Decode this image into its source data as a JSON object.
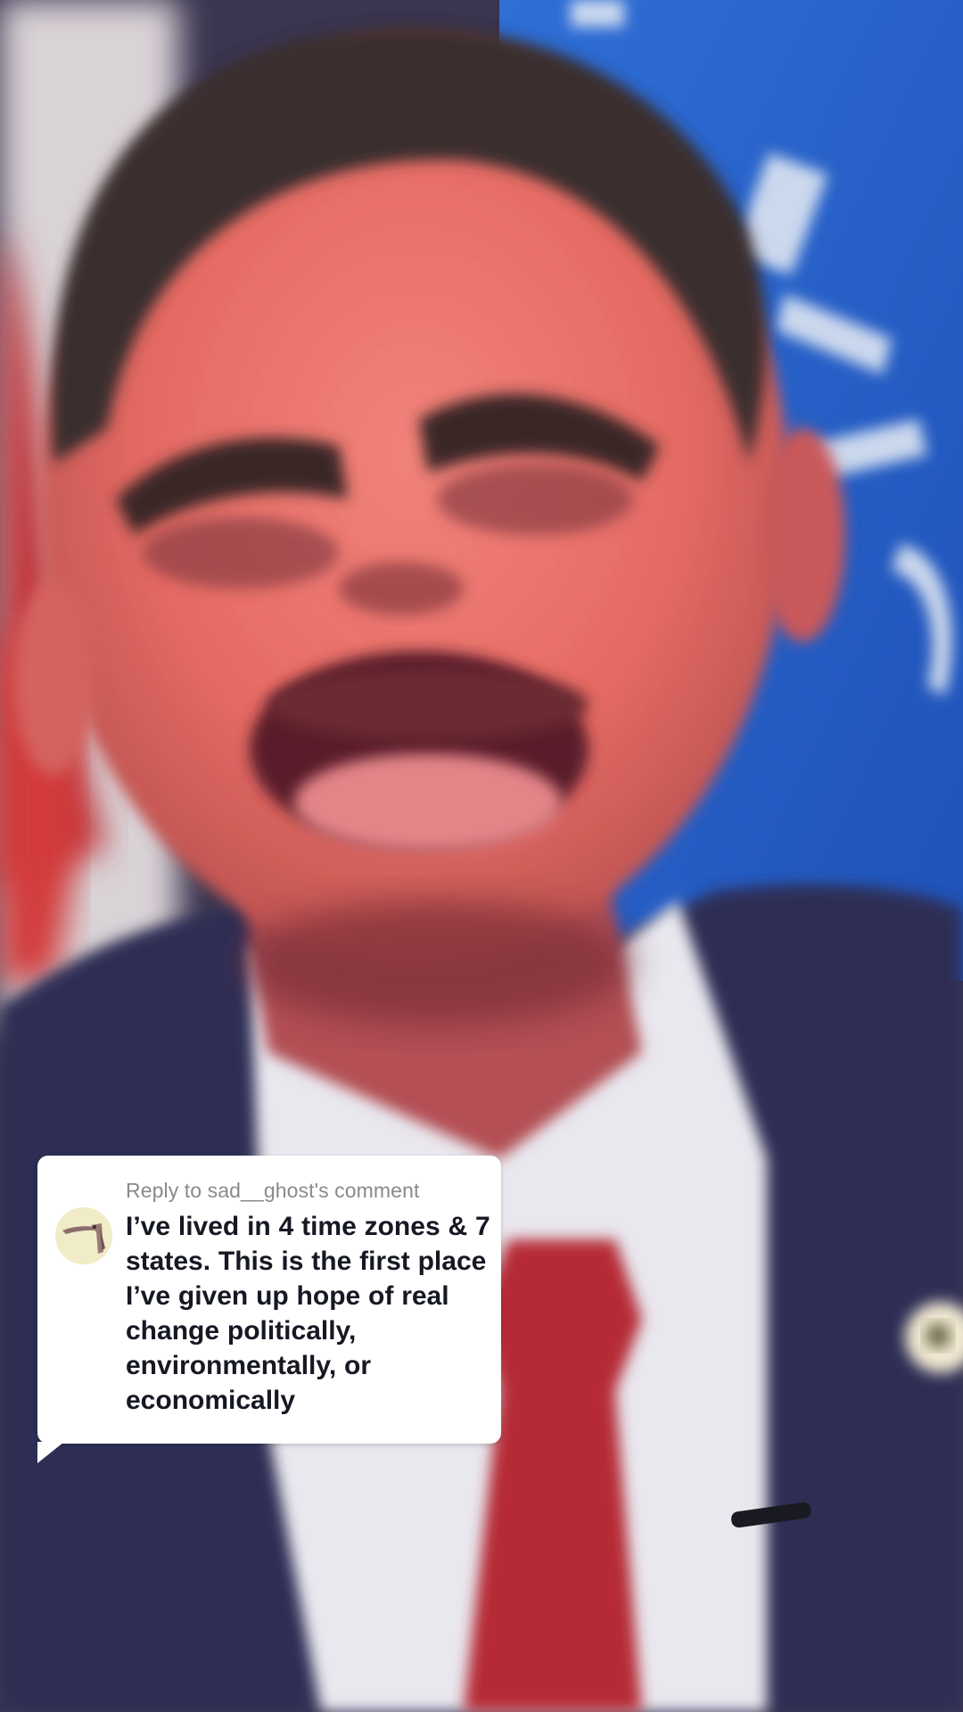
{
  "reply": {
    "header": "Reply to sad__ghost's comment",
    "text": "I’ve lived in 4 time zones & 7 states. This is the first place I’ve given up hope of real change politically, environmentally, or economically"
  },
  "icons": {
    "avatar": "user-avatar-bird",
    "tail": "speech-bubble-tail"
  },
  "colors": {
    "card_background": "#ffffff",
    "header_text": "#8a8a8a",
    "body_text": "#161823",
    "avatar_background": "#f0ecc8"
  }
}
